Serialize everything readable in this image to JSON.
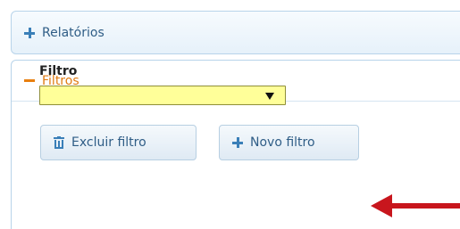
{
  "accordion": {
    "relatorios_label": "Relatórios",
    "filtros_label": "Filtros"
  },
  "filter": {
    "label": "Filtro",
    "selected_value": ""
  },
  "buttons": {
    "delete_label": "Excluir filtro",
    "new_label": "Novo filtro"
  },
  "colors": {
    "panel_border": "#b8d4ea",
    "header_text": "#2f5d86",
    "active_text": "#e07a10",
    "select_bg": "#ffff99",
    "annotation_arrow": "#c8161d"
  },
  "icons": {
    "relatorios": "plus-icon",
    "filtros": "minus-icon",
    "delete": "trash-icon",
    "new": "plus-icon",
    "select": "chevron-down-icon"
  }
}
